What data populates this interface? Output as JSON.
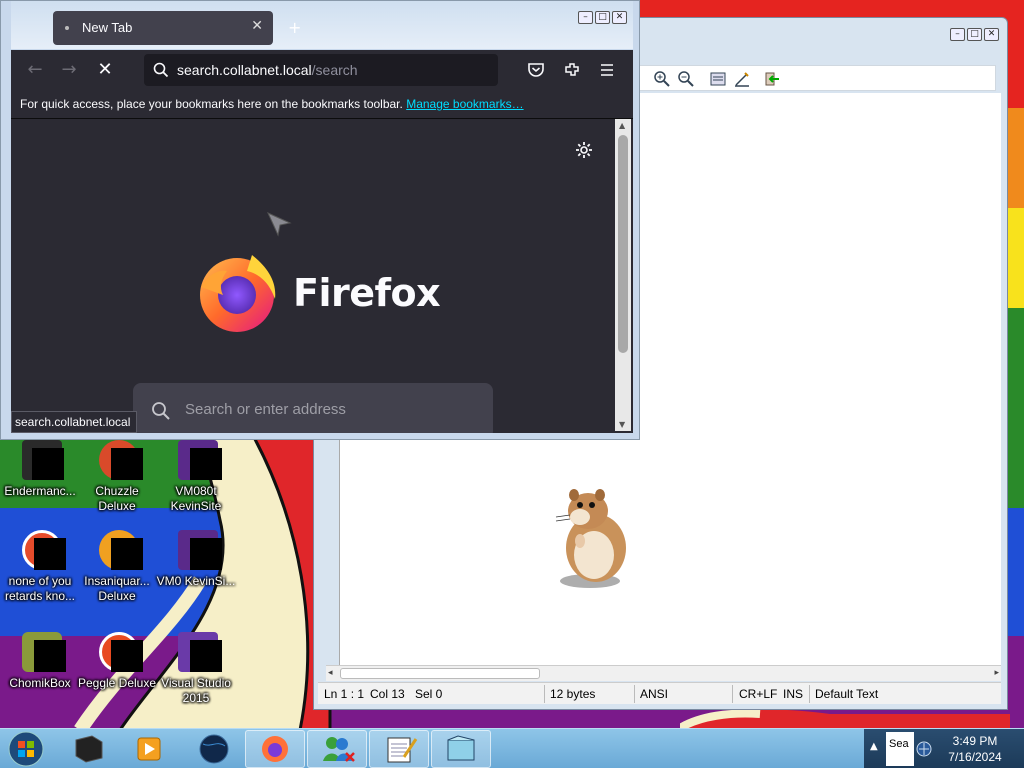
{
  "desktop": {
    "icons": [
      {
        "label": "Endermanc...",
        "icon": "enderman-icon"
      },
      {
        "label": "Chuzzle Deluxe",
        "icon": "chuzzle-icon"
      },
      {
        "label": "VM080t KevinSite",
        "icon": "vm-icon"
      },
      {
        "label": "none of you retards kno...",
        "icon": "chrome-icon"
      },
      {
        "label": "Insaniquar... Deluxe",
        "icon": "insaniquarium-icon"
      },
      {
        "label": "VM0 KevinSi...",
        "icon": "vm-icon"
      },
      {
        "label": "ChomikBox",
        "icon": "chomikbox-icon"
      },
      {
        "label": "Peggle Deluxe",
        "icon": "peggle-icon"
      },
      {
        "label": "Visual Studio 2015",
        "icon": "visual-studio-icon"
      }
    ]
  },
  "firefox": {
    "tab_title": "New Tab",
    "url_host": "search.collabnet.local",
    "url_path": "/search",
    "bookmarks_message": "For quick access, place your bookmarks here on the bookmarks toolbar.",
    "bookmarks_link": "Manage bookmarks…",
    "wordmark": "Firefox",
    "search_placeholder": "Search or enter address",
    "status_link": "search.collabnet.local"
  },
  "editor": {
    "status": {
      "position": "Ln 1 : 1",
      "column": "Col 13",
      "selection": "Sel 0",
      "size": "12 bytes",
      "encoding": "ANSI",
      "line_endings": "CR+LF",
      "mode": "INS",
      "scheme": "Default Text"
    }
  },
  "taskbar": {
    "items": [
      "cube-app-icon",
      "media-player-icon",
      "globe-icon",
      "firefox-icon",
      "messenger-icon",
      "notepad-icon",
      "notepad-blue-icon"
    ],
    "time": "3:49 PM",
    "date": "7/16/2024",
    "tray_text": "Sea"
  },
  "colors": {
    "firefox_chrome": "#2b2a33",
    "firefox_link": "#00ddff",
    "taskbar": "#8ec5e8"
  }
}
